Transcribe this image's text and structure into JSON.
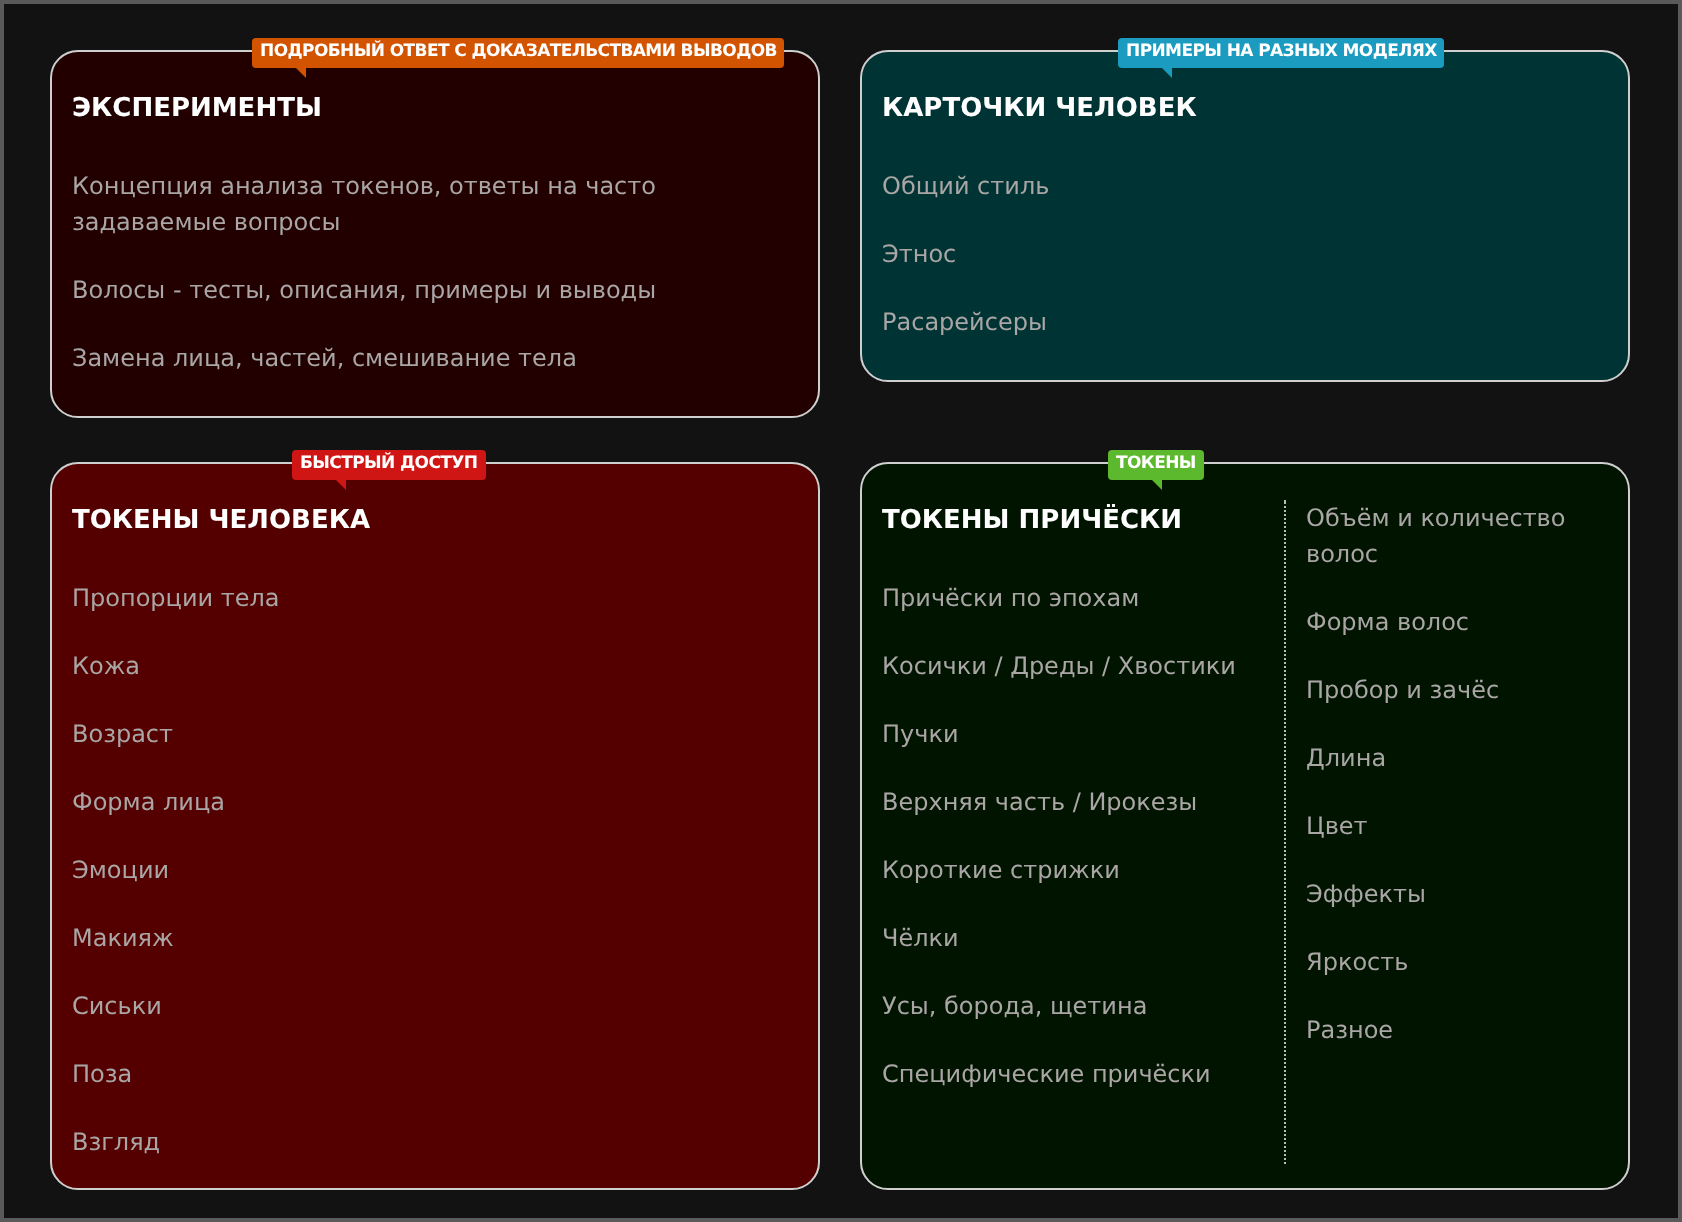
{
  "cards": [
    {
      "title": "ЭКСПЕРИМЕНТЫ",
      "color": "#220000",
      "badge": {
        "text": "ПОДРОБНЫЙ ОТВЕТ С ДОКАЗАТЕЛЬСТВАМИ ВЫВОДОВ",
        "color": "#d35400"
      },
      "columns": [
        {
          "items": [
            "Концепция анализа токенов, ответы на часто задаваемые вопросы",
            "Волосы - тесты, описания, примеры и выводы",
            "Замена лица, частей, смешивание тела"
          ]
        }
      ]
    },
    {
      "title": "КАРТОЧКИ ЧЕЛОВЕК",
      "color": "#003333",
      "badge": {
        "text": "ПРИМЕРЫ НА РАЗНЫХ МОДЕЛЯХ",
        "color": "#1a9bbf"
      },
      "columns": [
        {
          "items": [
            "Общий стиль",
            "Этнос",
            "Расарейсеры"
          ]
        }
      ]
    },
    {
      "title": "ТОКЕНЫ ЧЕЛОВЕКА",
      "color": "#550000",
      "badge": {
        "text": "БЫСТРЫЙ ДОСТУП",
        "color": "#d01515"
      },
      "columns": [
        {
          "items": [
            "Пропорции тела",
            "Кожа",
            "Возраст",
            "Форма лица",
            "Эмоции",
            "Макияж",
            "Сиськи",
            "Поза",
            "Взгляд"
          ]
        }
      ]
    },
    {
      "title": "ТОКЕНЫ ПРИЧЁСКИ",
      "color": "#001400",
      "badge": {
        "text": "ТОКЕНЫ",
        "color": "#5cb82c"
      },
      "columns": [
        {
          "items": [
            "Причёски по эпохам",
            "Косички / Дреды / Хвостики",
            "Пучки",
            "Верхняя часть / Ирокезы",
            "Короткие стрижки",
            "Чёлки",
            "Усы, борода, щетина",
            "Специфические причёски"
          ]
        },
        {
          "items": [
            "Объём и количество волос",
            "Форма волос",
            "Пробор и зачёс",
            "Длина",
            "Цвет",
            "Эффекты",
            "Яркость",
            "Разное"
          ]
        }
      ]
    }
  ]
}
